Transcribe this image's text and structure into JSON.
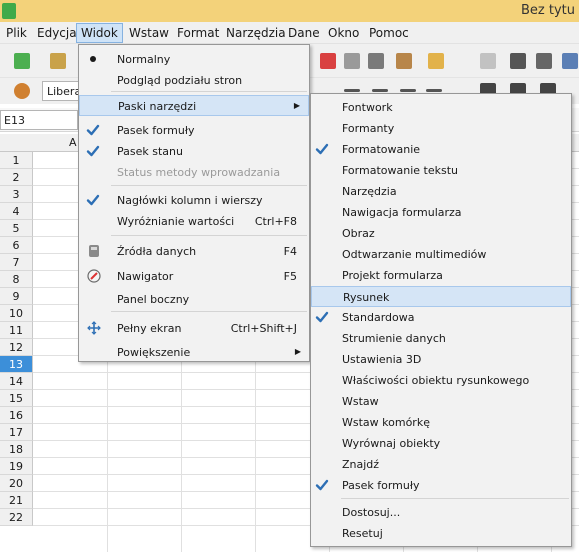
{
  "window": {
    "title": "Bez tytu"
  },
  "menubar": [
    "Plik",
    "Edycja",
    "Widok",
    "Wstaw",
    "Format",
    "Narzędzia",
    "Dane",
    "Okno",
    "Pomoc"
  ],
  "toolbar": {
    "font_name": "Libera"
  },
  "formula_bar": {
    "name_box": "E13"
  },
  "grid": {
    "column_a": "A",
    "rows": [
      "1",
      "2",
      "3",
      "4",
      "5",
      "6",
      "7",
      "8",
      "9",
      "10",
      "11",
      "12",
      "13",
      "14",
      "15",
      "16",
      "17",
      "18",
      "19",
      "20",
      "21",
      "22"
    ],
    "selected_row": "13"
  },
  "view_menu": {
    "items": [
      {
        "label": "Normalny",
        "mark": "bullet"
      },
      {
        "label": "Podgląd podziału stron"
      },
      {
        "label": "Paski narzędzi",
        "submenu": true,
        "highlighted": true
      },
      {
        "label": "Pasek formuły",
        "mark": "check"
      },
      {
        "label": "Pasek stanu",
        "mark": "check"
      },
      {
        "label": "Status metody wprowadzania",
        "disabled": true
      },
      {
        "label": "Nagłówki kolumn i wierszy",
        "mark": "check"
      },
      {
        "label": "Wyróżnianie wartości",
        "shortcut": "Ctrl+F8"
      },
      {
        "label": "Źródła danych",
        "shortcut": "F4",
        "icon": "database-icon"
      },
      {
        "label": "Nawigator",
        "shortcut": "F5",
        "icon": "navigator-compass-icon"
      },
      {
        "label": "Panel boczny"
      },
      {
        "label": "Pełny ekran",
        "shortcut": "Ctrl+Shift+J",
        "icon": "fullscreen-icon"
      },
      {
        "label": "Powiększenie",
        "submenu": true
      }
    ]
  },
  "toolbars_submenu": {
    "items": [
      {
        "label": "Fontwork"
      },
      {
        "label": "Formanty"
      },
      {
        "label": "Formatowanie",
        "checked": true
      },
      {
        "label": "Formatowanie tekstu"
      },
      {
        "label": "Narzędzia"
      },
      {
        "label": "Nawigacja formularza"
      },
      {
        "label": "Obraz"
      },
      {
        "label": "Odtwarzanie multimediów"
      },
      {
        "label": "Projekt formularza"
      },
      {
        "label": "Rysunek",
        "highlighted": true
      },
      {
        "label": "Standardowa",
        "checked": true
      },
      {
        "label": "Strumienie danych"
      },
      {
        "label": "Ustawienia 3D"
      },
      {
        "label": "Właściwości obiektu rysunkowego"
      },
      {
        "label": "Wstaw"
      },
      {
        "label": "Wstaw komórkę"
      },
      {
        "label": "Wyrównaj obiekty"
      },
      {
        "label": "Znajdź"
      },
      {
        "label": "Pasek formuły",
        "checked": true
      },
      {
        "label": "Dostosuj..."
      },
      {
        "label": "Resetuj"
      }
    ]
  },
  "colors": {
    "highlight": "#d5e5f6",
    "check": "#2d6fb5",
    "selected_row_header": "#3c8fd9"
  }
}
